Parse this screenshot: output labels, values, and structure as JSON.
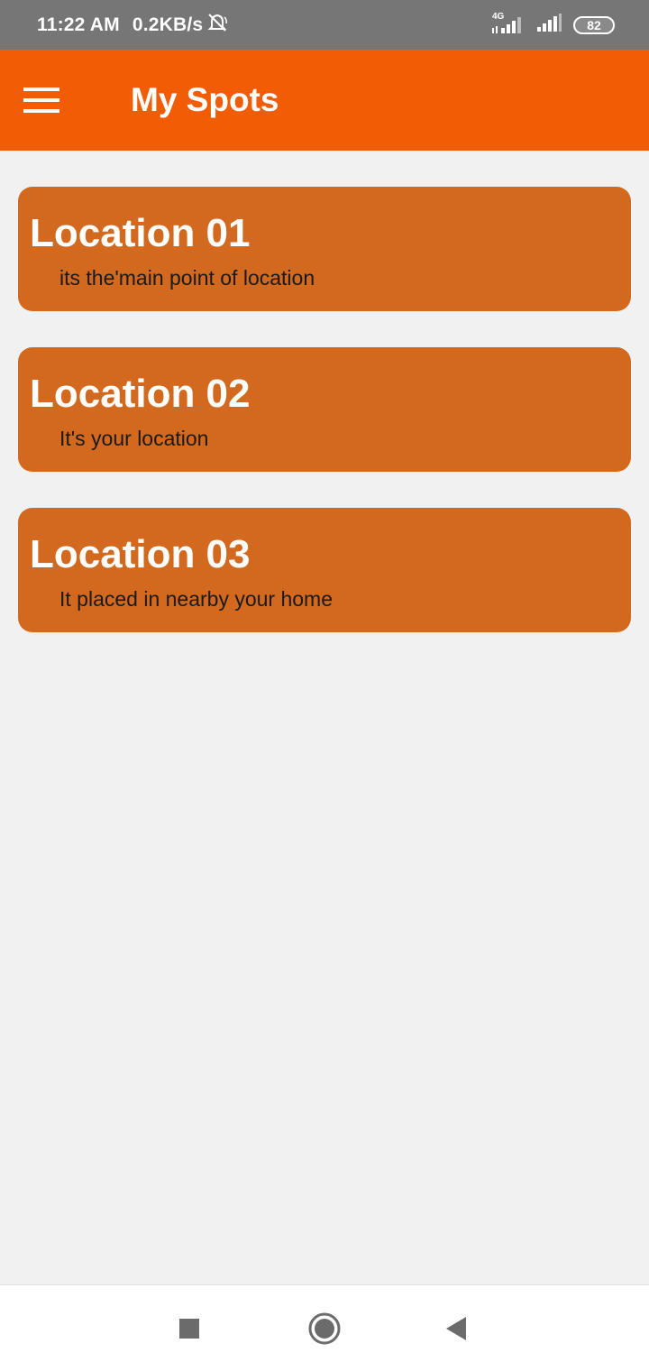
{
  "status_bar": {
    "time": "11:22 AM",
    "net_speed": "0.2KB/s",
    "network_type": "4G",
    "battery": "82",
    "icons": [
      "mute-bell-icon",
      "signal-4g-icon",
      "signal-icon",
      "battery-icon"
    ]
  },
  "app_bar": {
    "title": "My Spots",
    "menu_icon": "hamburger-menu-icon"
  },
  "locations": [
    {
      "title": "Location 01",
      "subtitle": "its the'main point of location"
    },
    {
      "title": "Location 02",
      "subtitle": "It's your location"
    },
    {
      "title": "Location 03",
      "subtitle": "It placed in nearby your home"
    }
  ],
  "nav_bar": {
    "icons": [
      "recents-square-icon",
      "home-circle-icon",
      "back-triangle-icon"
    ]
  },
  "colors": {
    "status_bar": "#767676",
    "app_bar": "#f25c05",
    "card": "#d2691e",
    "background": "#f1f1f1"
  }
}
